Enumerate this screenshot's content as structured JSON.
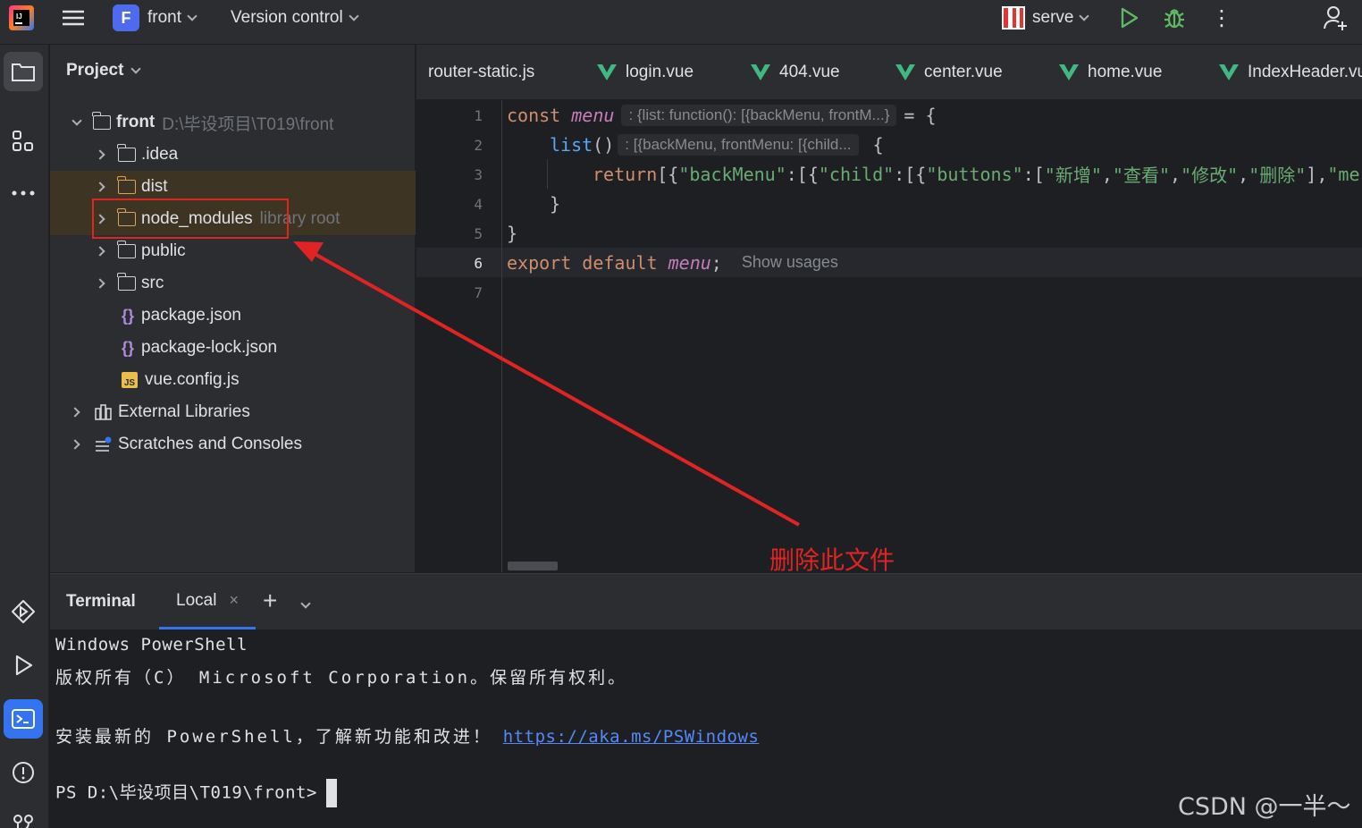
{
  "topbar": {
    "project_badge": "F",
    "project_name": "front",
    "vcs_label": "Version control",
    "run_config": "serve",
    "more": "⋮"
  },
  "project_panel": {
    "title": "Project",
    "root": {
      "name": "front",
      "path": "D:\\毕设项目\\T019\\front"
    },
    "items": [
      {
        "label": ".idea",
        "type": "folder"
      },
      {
        "label": "dist",
        "type": "folder-excluded"
      },
      {
        "label": "node_modules",
        "suffix": "library root",
        "type": "folder-excluded"
      },
      {
        "label": "public",
        "type": "folder"
      },
      {
        "label": "src",
        "type": "folder"
      },
      {
        "label": "package.json",
        "type": "json"
      },
      {
        "label": "package-lock.json",
        "type": "json"
      },
      {
        "label": "vue.config.js",
        "type": "js"
      },
      {
        "label": "External Libraries",
        "type": "libraries"
      },
      {
        "label": "Scratches and Consoles",
        "type": "scratches"
      }
    ]
  },
  "editor": {
    "tabs": [
      {
        "label": "router-static.js",
        "icon": "none"
      },
      {
        "label": "login.vue",
        "icon": "vue-icon"
      },
      {
        "label": "404.vue",
        "icon": "vue-icon"
      },
      {
        "label": "center.vue",
        "icon": "vue-icon"
      },
      {
        "label": "home.vue",
        "icon": "vue-icon"
      },
      {
        "label": "IndexHeader.vu",
        "icon": "vue-icon"
      }
    ],
    "line_numbers": [
      "1",
      "2",
      "3",
      "4",
      "5",
      "6",
      "7"
    ],
    "code": {
      "l1_kw": "const",
      "l1_var": "menu",
      "l1_hint": ": {list: function(): [{backMenu, frontM...}",
      "l1_rest": " = {",
      "l2_fn": "list",
      "l2_paren": "()",
      "l2_hint": ": [{backMenu, frontMenu: [{child...",
      "l2_rest": "{",
      "l3_kw": "return",
      "l3_p1": " [{",
      "l3_s1": "\"backMenu\"",
      "l3_p2": ":[{",
      "l3_s2": "\"child\"",
      "l3_p3": ":[{",
      "l3_s3": "\"buttons\"",
      "l3_p4": ":[",
      "l3_s4": "\"新增\"",
      "l3_c1": ",",
      "l3_s5": "\"查看\"",
      "l3_c2": ",",
      "l3_s6": "\"修改\"",
      "l3_c3": ",",
      "l3_s7": "\"删除\"",
      "l3_p5": "],",
      "l3_s8": "\"me",
      "l4": "}",
      "l5": "}",
      "l6_kw": "export default",
      "l6_var": "menu",
      "l6_semi": ";",
      "l6_usages": "Show usages"
    }
  },
  "annotation": {
    "text": "删除此文件"
  },
  "terminal": {
    "title": "Terminal",
    "tab_label": "Local",
    "close": "×",
    "plus": "+",
    "lines": {
      "l1": "Windows PowerShell",
      "l2": "版权所有（C） Microsoft Corporation。保留所有权利。",
      "l3_prefix": "安装最新的 PowerShell，了解新功能和改进！",
      "l3_link": "https://aka.ms/PSWindows",
      "prompt": "PS D:\\毕设项目\\T019\\front>"
    }
  },
  "watermark": "CSDN @一半～",
  "colors": {
    "accent": "#3574f0",
    "annotation": "#e02424",
    "vue_green": "#41b883",
    "keyword": "#cf8e6d",
    "string": "#6aab73"
  }
}
